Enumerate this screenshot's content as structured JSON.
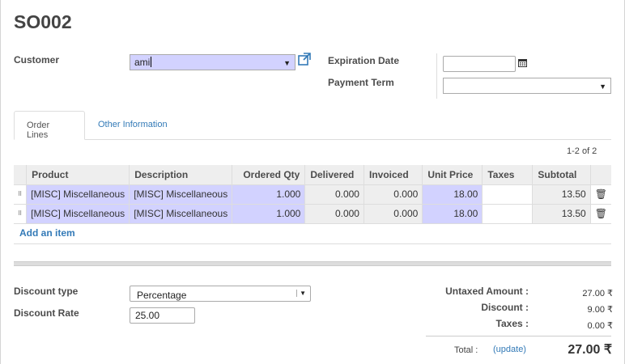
{
  "record": {
    "title": "SO002"
  },
  "header": {
    "customer_label": "Customer",
    "customer_value": "ami",
    "expiration_label": "Expiration Date",
    "expiration_value": "",
    "payment_term_label": "Payment Term",
    "payment_term_value": ""
  },
  "tabs": [
    {
      "label": "Order Lines",
      "active": true
    },
    {
      "label": "Other Information",
      "active": false
    }
  ],
  "pager": "1-2 of 2",
  "table": {
    "columns": [
      "Product",
      "Description",
      "Ordered Qty",
      "Delivered",
      "Invoiced",
      "Unit Price",
      "Taxes",
      "Subtotal"
    ],
    "rows": [
      [
        "[MISC] Miscellaneous",
        "[MISC] Miscellaneous",
        "1.000",
        "0.000",
        "0.000",
        "18.00",
        "",
        "13.50"
      ],
      [
        "[MISC] Miscellaneous",
        "[MISC] Miscellaneous",
        "1.000",
        "0.000",
        "0.000",
        "18.00",
        "",
        "13.50"
      ]
    ],
    "add_item": "Add an item"
  },
  "discount": {
    "type_label": "Discount type",
    "type_value": "Percentage",
    "rate_label": "Discount Rate",
    "rate_value": "25.00"
  },
  "summary": {
    "untaxed_label": "Untaxed Amount :",
    "untaxed_value": "27.00 ₹",
    "discount_label": "Discount :",
    "discount_value": "9.00 ₹",
    "taxes_label": "Taxes :",
    "taxes_value": "0.00 ₹",
    "total_label": "Total :",
    "update_label": "(update)",
    "total_value": "27.00 ₹"
  },
  "colors": {
    "required_field": "#d2d2ff",
    "link": "#337ab7",
    "header_bg": "#eeeeee"
  }
}
